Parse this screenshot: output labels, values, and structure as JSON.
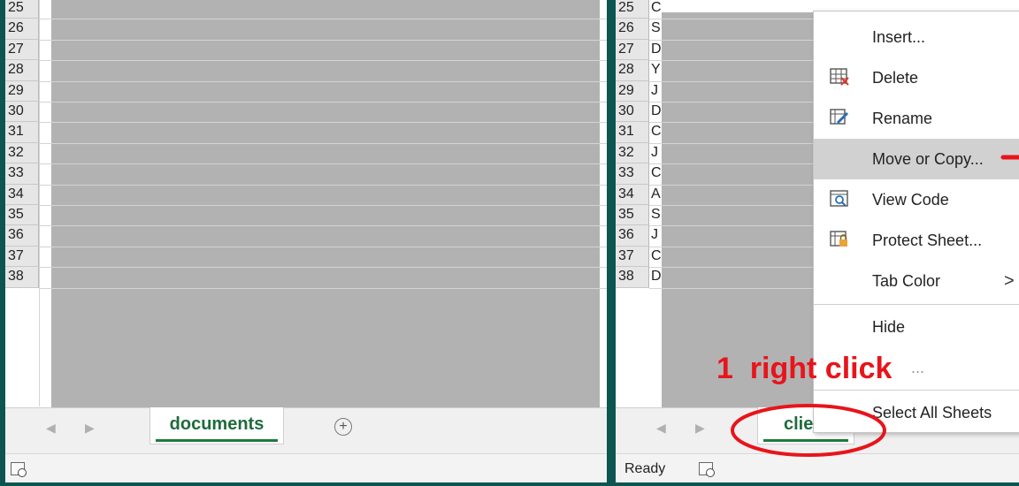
{
  "left_pane": {
    "rows": [
      "25",
      "26",
      "27",
      "28",
      "29",
      "30",
      "31",
      "32",
      "33",
      "34",
      "35",
      "36",
      "37",
      "38"
    ],
    "sheet_tab": "documents",
    "add_sheet_symbol": "+",
    "nav_prev": "◀",
    "nav_next": "▶"
  },
  "right_pane": {
    "rows": [
      "25",
      "26",
      "27",
      "28",
      "29",
      "30",
      "31",
      "32",
      "33",
      "34",
      "35",
      "36",
      "37",
      "38"
    ],
    "visible_cell_fragments": [
      "C",
      "S",
      "D",
      "Y",
      "J",
      "D",
      "C",
      "J",
      "C",
      "A",
      "S",
      "J",
      "C",
      "D"
    ],
    "sheet_tab": "clie...",
    "status_text": "Ready",
    "nav_prev": "◀",
    "nav_next": "▶"
  },
  "context_menu": {
    "items": [
      {
        "label": "Insert...",
        "icon": ""
      },
      {
        "label": "Delete",
        "icon": "delete-sheet-icon"
      },
      {
        "label": "Rename",
        "icon": "rename-sheet-icon"
      },
      {
        "label": "Move or Copy...",
        "icon": "",
        "highlighted": true
      },
      {
        "label": "View Code",
        "icon": "view-code-icon"
      },
      {
        "label": "Protect Sheet...",
        "icon": "protect-sheet-icon"
      },
      {
        "label": "Tab Color",
        "icon": "",
        "submenu_arrow": ">"
      },
      {
        "label": "Hide",
        "icon": ""
      },
      {
        "label": "...",
        "icon": ""
      },
      {
        "label": "Select All Sheets",
        "icon": ""
      }
    ]
  },
  "annotation": {
    "text": "1  right click",
    "color": "#e8141b"
  },
  "colors": {
    "background": "#0c5550",
    "tab_text": "#1f6b3c",
    "highlight": "#d1d1d1",
    "annotation": "#e8141b"
  }
}
